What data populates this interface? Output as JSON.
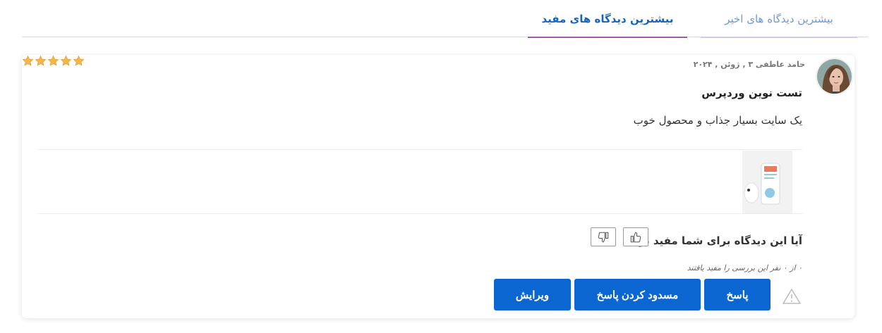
{
  "tabs": {
    "recent": "بیشترین دیدگاه های اخیر",
    "helpful": "بیشترین دیدگاه های مفید"
  },
  "review": {
    "rating": 5,
    "meta": "حامد عاطفی ۳ , ژوئن , ۲۰۲۴",
    "title": "تست نوین وردپرس",
    "body": "یک سایت بسیار جذاب و محصول خوب",
    "helpful_question": "آیا این دیدگاه برای شما مفید بود؟",
    "helpful_stat": "۰ از ۰ نفر این بررسی را مفید یافتند"
  },
  "actions": {
    "reply": "پاسخ",
    "block_reply": "مسدود کردن پاسخ",
    "edit": "ویرایش"
  },
  "colors": {
    "primary": "#0b66d1",
    "star": "#f2b64f",
    "tab_active": "#1565c0",
    "tab_inactive": "#6b9bd8"
  },
  "icons": {
    "rating": "star-icon",
    "vote_up": "thumbs-up-icon",
    "vote_down": "thumbs-down-icon",
    "report": "warning-icon"
  }
}
